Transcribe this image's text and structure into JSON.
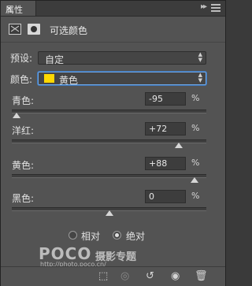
{
  "panel": {
    "tab_label": "属性",
    "tab_close": "×",
    "collapse_glyph": "▸▸",
    "header_title": "可选颜色"
  },
  "preset": {
    "label": "预设:",
    "value": "自定"
  },
  "colors": {
    "label": "颜色:",
    "value": "黄色",
    "swatch_color": "#ffd800"
  },
  "sliders": [
    {
      "label": "青色:",
      "value": "-95",
      "unit": "%",
      "level": -95
    },
    {
      "label": "洋红:",
      "value": "+72",
      "unit": "%",
      "level": 72
    },
    {
      "label": "黄色:",
      "value": "+88",
      "unit": "%",
      "level": 88
    },
    {
      "label": "黑色:",
      "value": "0",
      "unit": "%",
      "level": 0
    }
  ],
  "method": {
    "relative_label": "相对",
    "absolute_label": "绝对",
    "selected": "absolute"
  },
  "watermark": {
    "brand": "POCO",
    "sub": "摄影专题",
    "url": "http://photo.poco.cn/"
  },
  "toolbar_icons": [
    "clip-to-layer-icon",
    "view-previous-state-icon",
    "reset-icon",
    "eye-icon",
    "trash-icon"
  ]
}
